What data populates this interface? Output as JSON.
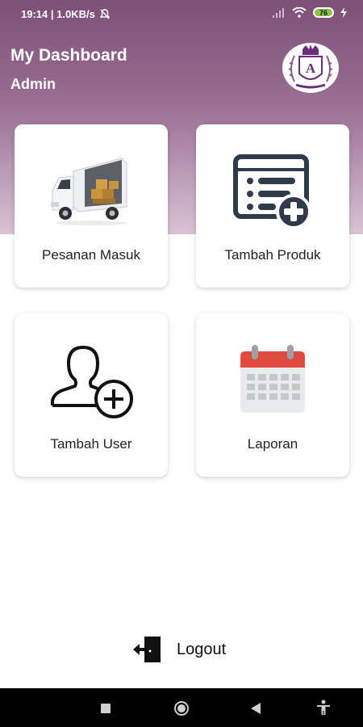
{
  "status_bar": {
    "time_speed": "19:14 | 1.0KB/s",
    "battery_level": "76"
  },
  "header": {
    "title": "My Dashboard",
    "subtitle": "Admin",
    "logo_letter": "A"
  },
  "menu": {
    "incoming_orders": "Pesanan Masuk",
    "add_product": "Tambah Produk",
    "add_user": "Tambah User",
    "report": "Laporan"
  },
  "logout": {
    "label": "Logout"
  },
  "colors": {
    "header_top": "#7e4f78",
    "calendar_red": "#e04a3f",
    "icon_dark": "#2f3a4a"
  }
}
